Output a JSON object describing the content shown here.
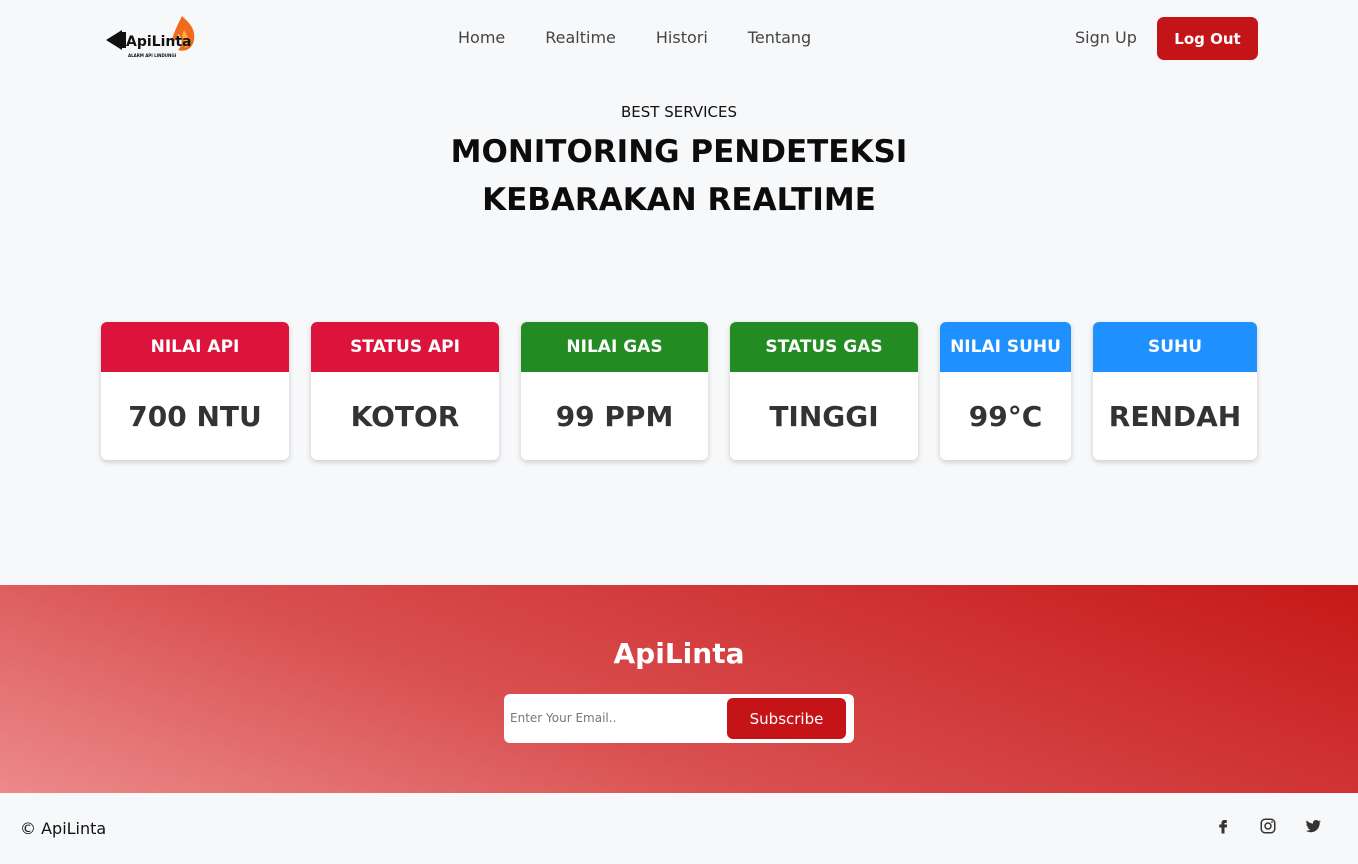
{
  "brand": {
    "logo_text": "ApiLinta",
    "logo_tagline": "ALARM API LINDUNGI"
  },
  "nav": {
    "items": [
      {
        "label": "Home"
      },
      {
        "label": "Realtime"
      },
      {
        "label": "Histori"
      },
      {
        "label": "Tentang"
      }
    ],
    "signup_label": "Sign Up",
    "logout_label": "Log Out"
  },
  "hero": {
    "subtitle": "BEST SERVICES",
    "title": "MONITORING PENDETEKSI KEBARAKAN REALTIME"
  },
  "cards": [
    {
      "label": "NILAI API",
      "value": "700 NTU",
      "color": "#dc143c"
    },
    {
      "label": "STATUS API",
      "value": "KOTOR",
      "color": "#dc143c"
    },
    {
      "label": "NILAI GAS",
      "value": "99 PPM",
      "color": "#228b22"
    },
    {
      "label": "STATUS GAS",
      "value": "TINGGI",
      "color": "#228b22"
    },
    {
      "label": "NILAI SUHU",
      "value": "99°C",
      "color": "#1e90ff"
    },
    {
      "label": "SUHU",
      "value": "RENDAH",
      "color": "#1e90ff"
    }
  ],
  "footer": {
    "title": "ApiLinta",
    "email_placeholder": "Enter Your Email..",
    "subscribe_label": "Subscribe",
    "copyright": "© ApiLinta",
    "social_icons": [
      "facebook-icon",
      "instagram-icon",
      "twitter-icon"
    ]
  },
  "colors": {
    "accent": "#c41418",
    "red_card": "#dc143c",
    "green_card": "#228b22",
    "blue_card": "#1e90ff"
  }
}
